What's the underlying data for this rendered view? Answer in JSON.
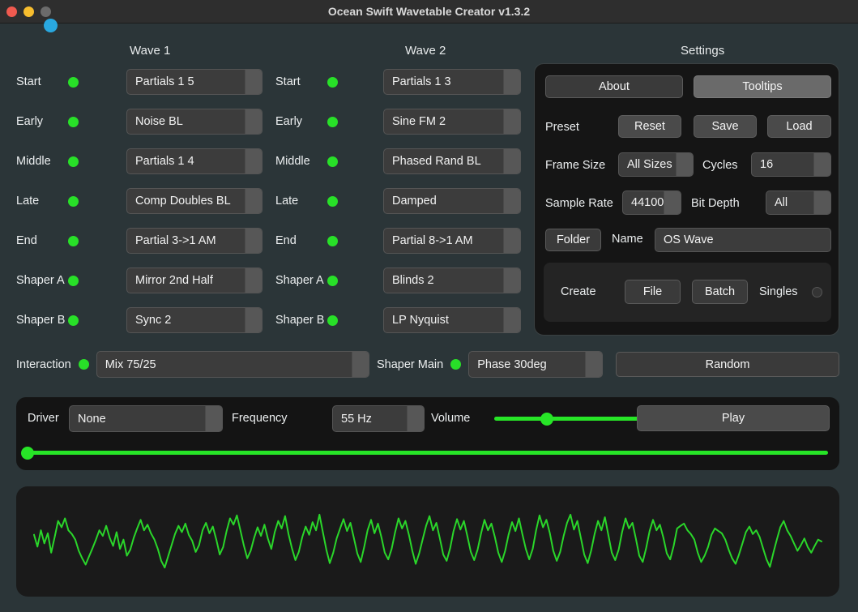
{
  "window": {
    "title": "Ocean Swift Wavetable Creator v1.3.2",
    "traffic_lights": [
      "close-red",
      "minimize-yellow",
      "zoom-gray"
    ],
    "accent_dot_color": "#29a8e0"
  },
  "colors": {
    "background": "#2b3538",
    "led_on": "#28e028",
    "panel_dark": "#151515",
    "accent_green": "#27e527",
    "waveform": "#2ad62a"
  },
  "wave1": {
    "header": "Wave 1",
    "rows": [
      {
        "label": "Start",
        "led": "on",
        "value": "Partials 1 5"
      },
      {
        "label": "Early",
        "led": "on",
        "value": "Noise BL"
      },
      {
        "label": "Middle",
        "led": "on",
        "value": "Partials 1 4"
      },
      {
        "label": "Late",
        "led": "on",
        "value": "Comp Doubles BL"
      },
      {
        "label": "End",
        "led": "on",
        "value": "Partial 3->1 AM"
      },
      {
        "label": "Shaper A",
        "led": "on",
        "value": "Mirror 2nd Half"
      },
      {
        "label": "Shaper B",
        "led": "on",
        "value": "Sync 2"
      }
    ]
  },
  "wave2": {
    "header": "Wave 2",
    "rows": [
      {
        "label": "Start",
        "led": "on",
        "value": "Partials 1 3"
      },
      {
        "label": "Early",
        "led": "on",
        "value": "Sine FM 2"
      },
      {
        "label": "Middle",
        "led": "on",
        "value": "Phased Rand BL"
      },
      {
        "label": "Late",
        "led": "on",
        "value": "Damped"
      },
      {
        "label": "End",
        "led": "on",
        "value": "Partial 8->1 AM"
      },
      {
        "label": "Shaper A",
        "led": "on",
        "value": "Blinds 2"
      },
      {
        "label": "Shaper B",
        "led": "on",
        "value": "LP Nyquist"
      }
    ]
  },
  "settings": {
    "title": "Settings",
    "about_label": "About",
    "tooltips_label": "Tooltips",
    "preset_label": "Preset",
    "reset_label": "Reset",
    "save_label": "Save",
    "load_label": "Load",
    "frame_size_label": "Frame Size",
    "frame_size_value": "All Sizes",
    "cycles_label": "Cycles",
    "cycles_value": "16",
    "sample_rate_label": "Sample Rate",
    "sample_rate_value": "44100",
    "bit_depth_label": "Bit Depth",
    "bit_depth_value": "All",
    "folder_label": "Folder",
    "name_label": "Name",
    "name_value": "OS Wave",
    "create_label": "Create",
    "file_label": "File",
    "batch_label": "Batch",
    "singles_label": "Singles",
    "singles_state": "off"
  },
  "interaction": {
    "label": "Interaction",
    "led": "on",
    "value": "Mix 75/25",
    "shaper_main_label": "Shaper Main",
    "shaper_main_led": "on",
    "shaper_main_value": "Phase 30deg",
    "random_label": "Random"
  },
  "transport": {
    "driver_label": "Driver",
    "driver_value": "None",
    "frequency_label": "Frequency",
    "frequency_value": "55 Hz",
    "volume_label": "Volume",
    "volume_percent": 35,
    "play_label": "Play",
    "position_percent": 0
  },
  "waveform": {
    "label": "waveform-display",
    "color": "#2ad62a",
    "samples": [
      0.18,
      -0.14,
      0.3,
      -0.05,
      0.22,
      -0.3,
      0.12,
      0.55,
      0.38,
      0.62,
      0.3,
      0.2,
      0.05,
      -0.25,
      -0.45,
      -0.62,
      -0.4,
      -0.18,
      0.05,
      0.3,
      0.15,
      0.42,
      0.1,
      -0.12,
      0.25,
      -0.2,
      0.05,
      -0.38,
      -0.22,
      0.1,
      0.35,
      0.58,
      0.3,
      0.45,
      0.22,
      0.05,
      -0.2,
      -0.52,
      -0.7,
      -0.4,
      -0.1,
      0.2,
      0.42,
      0.25,
      0.48,
      0.18,
      0.02,
      -0.28,
      -0.1,
      0.3,
      0.5,
      0.22,
      0.4,
      0.05,
      -0.35,
      -0.15,
      0.28,
      0.62,
      0.45,
      0.7,
      0.3,
      -0.1,
      -0.45,
      -0.25,
      0.1,
      0.38,
      0.15,
      0.45,
      0.08,
      -0.2,
      0.25,
      0.55,
      0.35,
      0.68,
      0.2,
      -0.18,
      -0.5,
      -0.28,
      0.12,
      0.4,
      0.18,
      0.52,
      0.3,
      0.72,
      0.25,
      -0.22,
      -0.58,
      -0.3,
      0.08,
      0.35,
      0.6,
      0.28,
      0.5,
      0.1,
      -0.32,
      -0.55,
      -0.15,
      0.3,
      0.58,
      0.22,
      0.48,
      0.12,
      -0.3,
      -0.48,
      -0.2,
      0.25,
      0.62,
      0.35,
      0.55,
      0.18,
      -0.25,
      -0.6,
      -0.32,
      0.05,
      0.42,
      0.68,
      0.3,
      0.5,
      0.08,
      -0.35,
      -0.52,
      -0.18,
      0.28,
      0.6,
      0.32,
      0.55,
      0.15,
      -0.28,
      -0.5,
      -0.22,
      0.22,
      0.58,
      0.3,
      0.48,
      0.12,
      -0.3,
      -0.55,
      -0.25,
      0.18,
      0.52,
      0.28,
      0.62,
      0.2,
      -0.2,
      -0.48,
      -0.2,
      0.3,
      0.7,
      0.38,
      0.58,
      0.22,
      -0.25,
      -0.52,
      -0.28,
      0.15,
      0.5,
      0.72,
      0.32,
      0.55,
      0.1,
      -0.35,
      -0.58,
      -0.25,
      0.2,
      0.55,
      0.3,
      0.65,
      0.18,
      -0.3,
      -0.5,
      -0.22,
      0.25,
      0.62,
      0.35,
      0.5,
      0.08,
      -0.38,
      -0.55,
      -0.18,
      0.28,
      0.58,
      0.3,
      0.45,
      0.1,
      -0.32,
      -0.48,
      -0.12,
      0.35,
      0.42,
      0.48,
      0.3,
      0.2,
      0.05,
      -0.3,
      -0.55,
      -0.38,
      -0.15,
      0.18,
      0.35,
      0.28,
      0.22,
      0.05,
      -0.22,
      -0.45,
      -0.6,
      -0.35,
      -0.05,
      0.25,
      0.4,
      0.2,
      0.3,
      0.12,
      -0.18,
      -0.48,
      -0.68,
      -0.3,
      0.05,
      0.38,
      0.55,
      0.3,
      0.15,
      -0.05,
      -0.25,
      -0.1,
      0.08,
      -0.15,
      -0.3,
      -0.12,
      0.05,
      0.0
    ]
  }
}
